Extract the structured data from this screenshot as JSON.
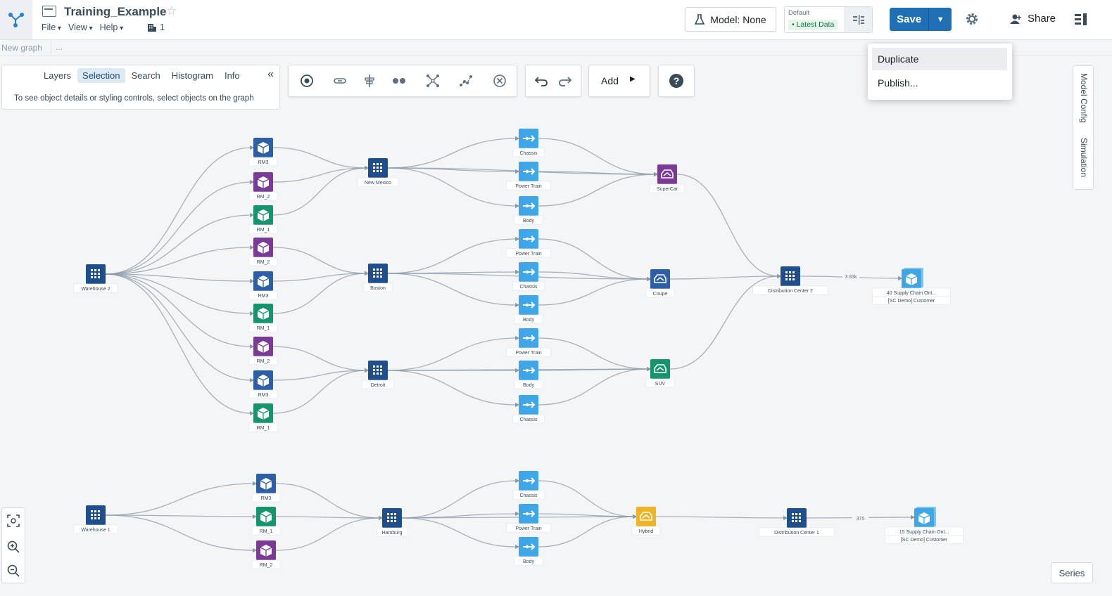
{
  "app": {
    "title": "Training_Example",
    "menus": [
      "File",
      "View",
      "Help"
    ],
    "object_count": "1",
    "breadcrumb": "New graph",
    "breadcrumb_more": "..."
  },
  "toolbar": {
    "model_label": "Model: None",
    "data_scenario_label": "Default",
    "data_badge": "• Latest Data",
    "save_label": "Save",
    "share_label": "Share",
    "add_label": "Add",
    "icons": [
      "select-icon",
      "link-icon",
      "align-icon",
      "group-icon",
      "expand-icon",
      "layout-icon",
      "remove-icon",
      "undo-icon",
      "redo-icon",
      "help-icon"
    ]
  },
  "save_menu": {
    "items": [
      "Duplicate",
      "Publish..."
    ]
  },
  "selection_panel": {
    "tabs": [
      "Layers",
      "Selection",
      "Search",
      "Histogram",
      "Info"
    ],
    "active_tab": "Selection",
    "hint": "To see object details or styling controls, select objects on the graph"
  },
  "side_tabs": [
    "Model Config",
    "Simulation"
  ],
  "series_label": "Series",
  "colors": {
    "accent": "#1f6fb4",
    "facility": "#1f4e8c",
    "component": "#3fa7e8",
    "rm3": "#2d5fa6",
    "rm2": "#7b3a96",
    "rm1": "#16956d",
    "hybrid": "#f0b323"
  },
  "graph": {
    "nodes": [
      {
        "id": "wh2",
        "label": "Warehouse 2",
        "kind": "facility"
      },
      {
        "id": "a_rm3",
        "label": "RM3",
        "kind": "rm3"
      },
      {
        "id": "a_rm2",
        "label": "RM_2",
        "kind": "rm2"
      },
      {
        "id": "a_rm1",
        "label": "RM_1",
        "kind": "rm1"
      },
      {
        "id": "b_rm2",
        "label": "RM_2",
        "kind": "rm2"
      },
      {
        "id": "b_rm3",
        "label": "RM3",
        "kind": "rm3"
      },
      {
        "id": "b_rm1",
        "label": "RM_1",
        "kind": "rm1"
      },
      {
        "id": "c_rm2",
        "label": "RM_2",
        "kind": "rm2"
      },
      {
        "id": "c_rm3",
        "label": "RM3",
        "kind": "rm3"
      },
      {
        "id": "c_rm1",
        "label": "RM_1",
        "kind": "rm1"
      },
      {
        "id": "nm",
        "label": "New Mexico",
        "kind": "facility"
      },
      {
        "id": "bos",
        "label": "Boston",
        "kind": "facility"
      },
      {
        "id": "det",
        "label": "Detroit",
        "kind": "facility"
      },
      {
        "id": "nm_ch",
        "label": "Chassis",
        "kind": "component"
      },
      {
        "id": "nm_pt",
        "label": "Power Train",
        "kind": "component"
      },
      {
        "id": "nm_bd",
        "label": "Body",
        "kind": "component"
      },
      {
        "id": "bos_pt",
        "label": "Power Train",
        "kind": "component"
      },
      {
        "id": "bos_ch",
        "label": "Chassis",
        "kind": "component"
      },
      {
        "id": "bos_bd",
        "label": "Body",
        "kind": "component"
      },
      {
        "id": "det_pt",
        "label": "Power Train",
        "kind": "component"
      },
      {
        "id": "det_bd",
        "label": "Body",
        "kind": "component"
      },
      {
        "id": "det_ch",
        "label": "Chassis",
        "kind": "component"
      },
      {
        "id": "supercar",
        "label": "SuperCar",
        "kind": "rm2-car"
      },
      {
        "id": "coupe",
        "label": "Coupe",
        "kind": "rm3-car"
      },
      {
        "id": "suv",
        "label": "SUV",
        "kind": "rm1-car"
      },
      {
        "id": "dc2",
        "label": "Distribution Center 2",
        "kind": "facility"
      },
      {
        "id": "cust40",
        "label": "40 Supply Chain Ont...",
        "sublabel": "[SC Demo] Customer",
        "kind": "customer"
      },
      {
        "id": "wh1",
        "label": "Warehouse 1",
        "kind": "facility"
      },
      {
        "id": "d_rm3",
        "label": "RM3",
        "kind": "rm3"
      },
      {
        "id": "d_rm1",
        "label": "RM_1",
        "kind": "rm1"
      },
      {
        "id": "d_rm2",
        "label": "RM_2",
        "kind": "rm2"
      },
      {
        "id": "ham",
        "label": "Hamburg",
        "kind": "facility"
      },
      {
        "id": "ham_ch",
        "label": "Chassis",
        "kind": "component"
      },
      {
        "id": "ham_pt",
        "label": "Power Train",
        "kind": "component"
      },
      {
        "id": "ham_bd",
        "label": "Body",
        "kind": "component"
      },
      {
        "id": "hybrid",
        "label": "Hybrid",
        "kind": "hybrid-car"
      },
      {
        "id": "dc1",
        "label": "Distribution Center 1",
        "kind": "facility"
      },
      {
        "id": "cust15",
        "label": "15 Supply Chain Ont...",
        "sublabel": "[SC Demo] Customer",
        "kind": "customer"
      }
    ],
    "edge_labels": {
      "dc2_cust40": "3.93k",
      "dc1_cust15": "375"
    }
  }
}
